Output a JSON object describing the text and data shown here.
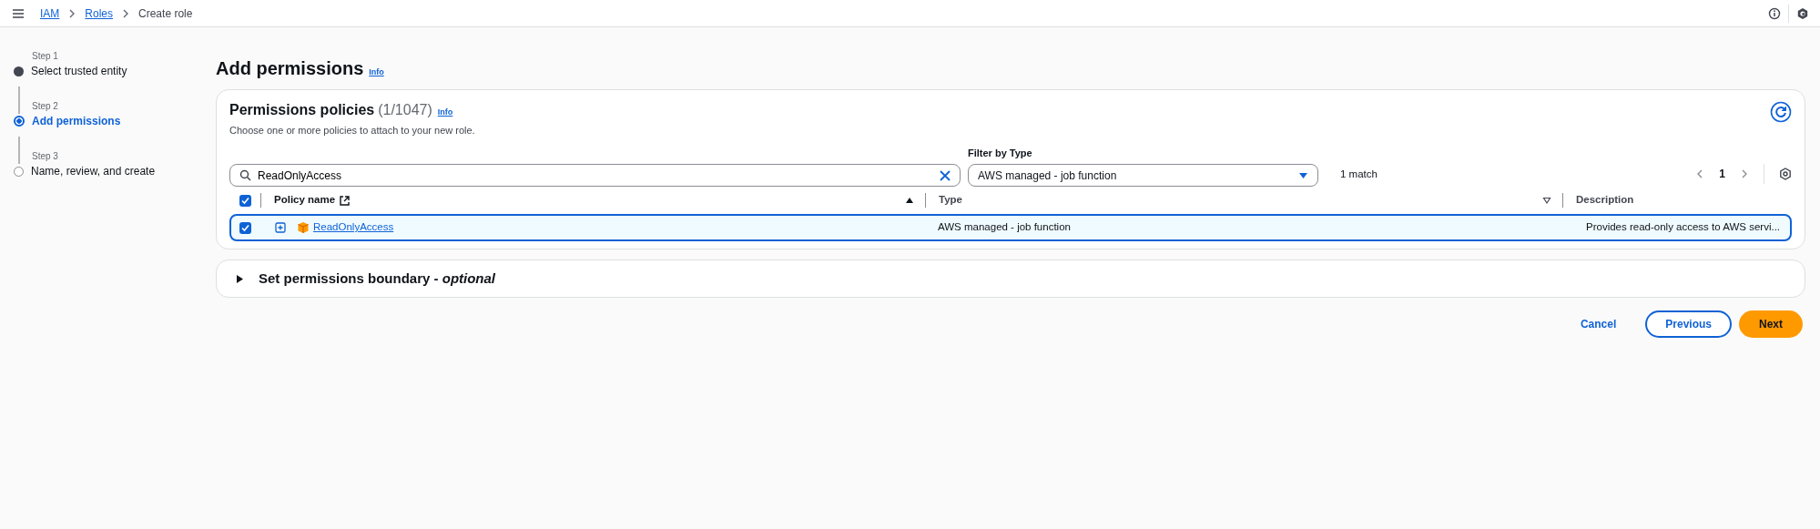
{
  "breadcrumbs": [
    {
      "label": "IAM",
      "link": true
    },
    {
      "label": "Roles",
      "link": true
    },
    {
      "label": "Create role",
      "link": false
    }
  ],
  "steps": [
    {
      "step": "Step 1",
      "label": "Select trusted entity",
      "completed": true,
      "selected": false
    },
    {
      "step": "Step 2",
      "label": "Add permissions",
      "completed": false,
      "selected": true
    },
    {
      "step": "Step 3",
      "label": "Name, review, and create",
      "completed": false,
      "selected": false
    }
  ],
  "page": {
    "title": "Add permissions",
    "info": "Info"
  },
  "policies": {
    "title": "Permissions policies",
    "count": "(1/1047)",
    "info": "Info",
    "description": "Choose one or more policies to attach to your new role.",
    "search_value": "ReadOnlyAccess",
    "filter_label": "Filter by Type",
    "filter_value": "AWS managed - job function",
    "match_count": "1 match",
    "current_page": "1",
    "select_all_checked": true,
    "columns": [
      {
        "label": "Policy name",
        "sortable": true,
        "sorted": true
      },
      {
        "label": "Type",
        "sortable": true,
        "sorted": false
      },
      {
        "label": "Description"
      }
    ],
    "rows": [
      {
        "checked": true,
        "selected": true,
        "name": "ReadOnlyAccess",
        "type": "AWS managed - job function",
        "description": "Provides read-only access to AWS servi..."
      }
    ]
  },
  "boundary": {
    "title": "Set permissions boundary - *optional*",
    "expanded": false
  },
  "actions": [
    {
      "label": "Cancel",
      "kind": "link"
    },
    {
      "label": "Previous",
      "kind": "secondary"
    },
    {
      "label": "Next",
      "kind": "primary"
    }
  ]
}
